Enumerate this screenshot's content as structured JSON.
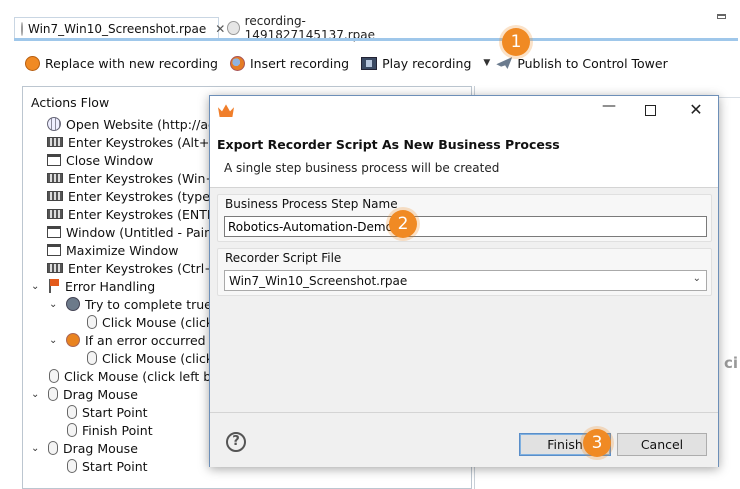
{
  "tabs": [
    {
      "label": "Win7_Win10_Screenshot.rpae",
      "close": "✕",
      "active": true
    },
    {
      "label": "recording-1491827145137.rpae",
      "active": false
    }
  ],
  "toolbar": {
    "replace_label": "Replace with new recording",
    "insert_label": "Insert recording",
    "play_label": "Play recording",
    "publish_label": "Publish to Control Tower"
  },
  "panel": {
    "title": "Actions Flow",
    "rows": [
      {
        "label": "Open Website (http://accu",
        "icon": "globe"
      },
      {
        "label": "Enter Keystrokes (Alt+PRIN",
        "icon": "keyboard"
      },
      {
        "label": "Close Window",
        "icon": "window"
      },
      {
        "label": "Enter Keystrokes (Win+r)",
        "icon": "keyboard"
      },
      {
        "label": "Enter Keystrokes (typed tex",
        "icon": "keyboard"
      },
      {
        "label": "Enter Keystrokes (ENTER)",
        "icon": "keyboard"
      },
      {
        "label": "Window (Untitled - Paint)",
        "icon": "window"
      },
      {
        "label": "Maximize Window",
        "icon": "window"
      },
      {
        "label": "Enter Keystrokes (Ctrl+v)",
        "icon": "keyboard"
      },
      {
        "label": "Error Handling",
        "icon": "flag"
      },
      {
        "label": "Try to complete true",
        "icon": "try"
      },
      {
        "label": "Click Mouse (click l",
        "icon": "mouse"
      },
      {
        "label": "If an error occurred true",
        "icon": "error"
      },
      {
        "label": "Click Mouse (click l",
        "icon": "mouse"
      },
      {
        "label": "Click Mouse (click left butt",
        "icon": "mouse"
      },
      {
        "label": "Drag Mouse",
        "icon": "mouse"
      },
      {
        "label": "Start Point",
        "icon": "mouse"
      },
      {
        "label": "Finish Point",
        "icon": "mouse"
      },
      {
        "label": "Drag Mouse",
        "icon": "mouse"
      },
      {
        "label": "Start Point",
        "icon": "mouse"
      }
    ],
    "ghost_text": "ci"
  },
  "dialog": {
    "heading": "Export Recorder Script As New Business Process",
    "subtitle": "A single step business process will be created",
    "step_name_label": "Business Process Step Name",
    "step_name_value": "Robotics-Automation-Demo",
    "script_file_label": "Recorder Script File",
    "script_file_value": "Win7_Win10_Screenshot.rpae",
    "help": "?",
    "finish_label": "Finish",
    "cancel_label": "Cancel"
  },
  "markers": [
    "1",
    "2",
    "3"
  ],
  "colors": {
    "accent": "#f08a24",
    "tab_underline": "#9fc7ea",
    "dialog_border": "#6d8fb8"
  }
}
